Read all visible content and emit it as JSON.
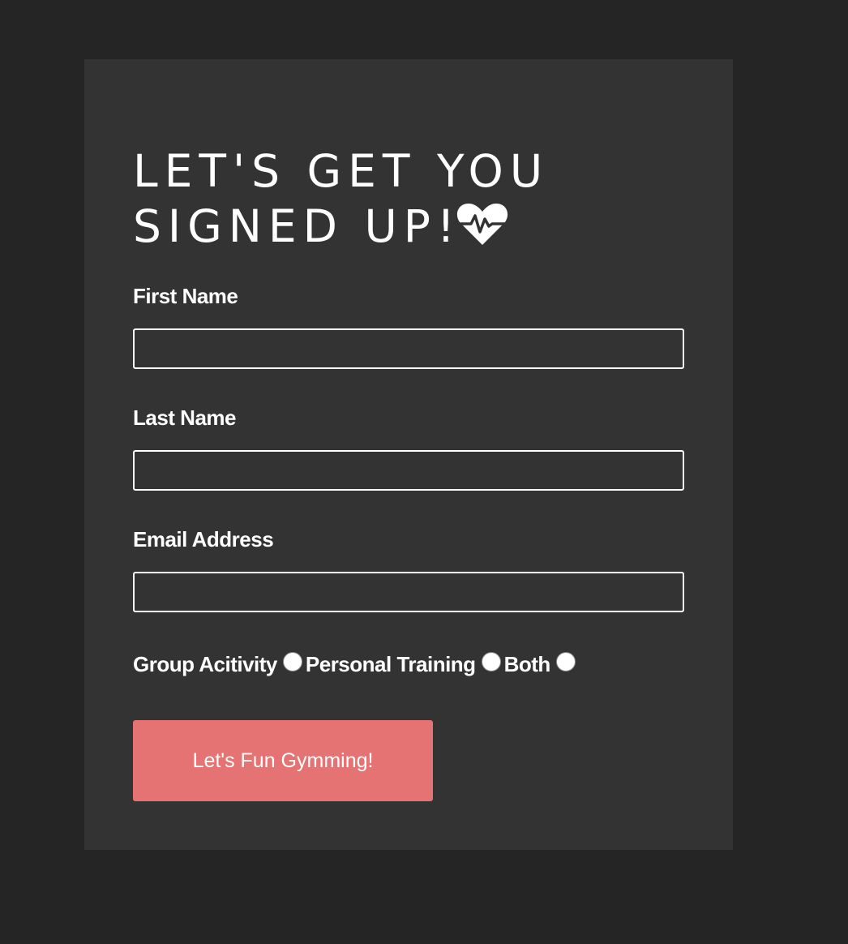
{
  "form": {
    "title_line1": "LET'S GET YOU",
    "title_line2": "SIGNED UP!",
    "title_icon": "heart-pulse-icon",
    "first_name_label": "First Name",
    "first_name_value": "",
    "last_name_label": "Last Name",
    "last_name_value": "",
    "email_label": "Email Address",
    "email_value": "",
    "options": [
      "Group Acitivity",
      "Personal Training",
      "Both"
    ],
    "submit_label": "Let's Fun Gymming!"
  },
  "colors": {
    "page_background": "#252525",
    "card_background": "#333333",
    "button_background": "#e57373",
    "text": "#ffffff"
  }
}
